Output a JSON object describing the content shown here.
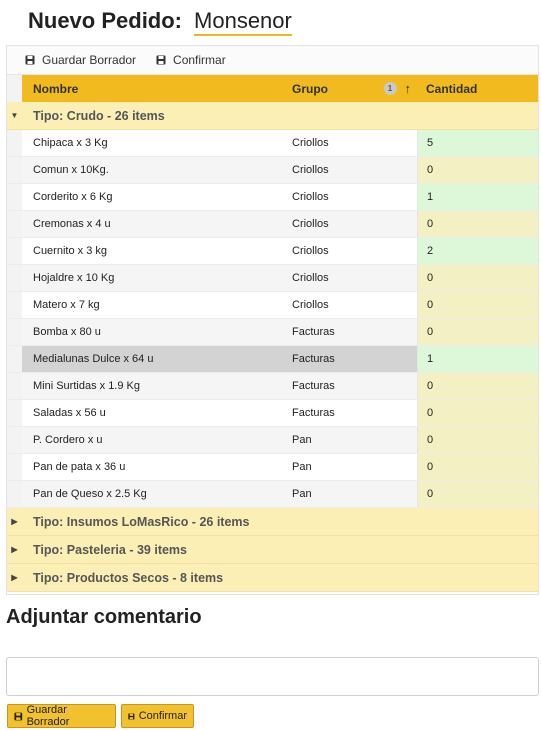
{
  "header": {
    "label": "Nuevo Pedido:",
    "client": "Monsenor"
  },
  "toolbar": {
    "save_label": "Guardar Borrador",
    "confirm_label": "Confirmar"
  },
  "columns": {
    "nombre": "Nombre",
    "grupo": "Grupo",
    "sort_order": "1",
    "cantidad": "Cantidad"
  },
  "groups": [
    {
      "label": "Tipo: Crudo - 26 items",
      "expanded": true,
      "rows": [
        {
          "nombre": "Chipaca x 3 Kg",
          "grupo": "Criollos",
          "cantidad": "5"
        },
        {
          "nombre": "Comun x 10Kg.",
          "grupo": "Criollos",
          "cantidad": "0"
        },
        {
          "nombre": "Corderito x 6 Kg",
          "grupo": "Criollos",
          "cantidad": "1"
        },
        {
          "nombre": "Cremonas x 4 u",
          "grupo": "Criollos",
          "cantidad": "0"
        },
        {
          "nombre": "Cuernito x 3 kg",
          "grupo": "Criollos",
          "cantidad": "2"
        },
        {
          "nombre": "Hojaldre x 10 Kg",
          "grupo": "Criollos",
          "cantidad": "0"
        },
        {
          "nombre": "Matero x 7 kg",
          "grupo": "Criollos",
          "cantidad": "0"
        },
        {
          "nombre": "Bomba x 80 u",
          "grupo": "Facturas",
          "cantidad": "0"
        },
        {
          "nombre": "Medialunas Dulce x 64 u",
          "grupo": "Facturas",
          "cantidad": "1"
        },
        {
          "nombre": "Mini Surtidas x 1.9 Kg",
          "grupo": "Facturas",
          "cantidad": "0"
        },
        {
          "nombre": "Saladas x 56 u",
          "grupo": "Facturas",
          "cantidad": "0"
        },
        {
          "nombre": "P. Cordero x u",
          "grupo": "Pan",
          "cantidad": "0"
        },
        {
          "nombre": "Pan de pata x 36 u",
          "grupo": "Pan",
          "cantidad": "0"
        },
        {
          "nombre": "Pan de Queso x 2.5 Kg",
          "grupo": "Pan",
          "cantidad": "0"
        }
      ]
    },
    {
      "label": "Tipo: Insumos LoMasRico - 26 items",
      "expanded": false
    },
    {
      "label": "Tipo: Pasteleria - 39 items",
      "expanded": false
    },
    {
      "label": "Tipo: Productos Secos - 8 items",
      "expanded": false
    }
  ],
  "comment": {
    "title": "Adjuntar comentario",
    "value": ""
  },
  "footer": {
    "save_label": "Guardar Borrador",
    "confirm_label": "Confirmar"
  },
  "colors": {
    "accent": "#f1bb1f",
    "group_bg": "#fbefb6",
    "qty_positive": "#ddf8d9",
    "qty_zero": "#f3f0c4",
    "selected_row": "#d3d3d3"
  },
  "icons": {
    "save": "floppy-disk-icon",
    "expanded": "caret-down-icon",
    "collapsed": "caret-right-icon",
    "sort": "arrow-up-icon"
  }
}
